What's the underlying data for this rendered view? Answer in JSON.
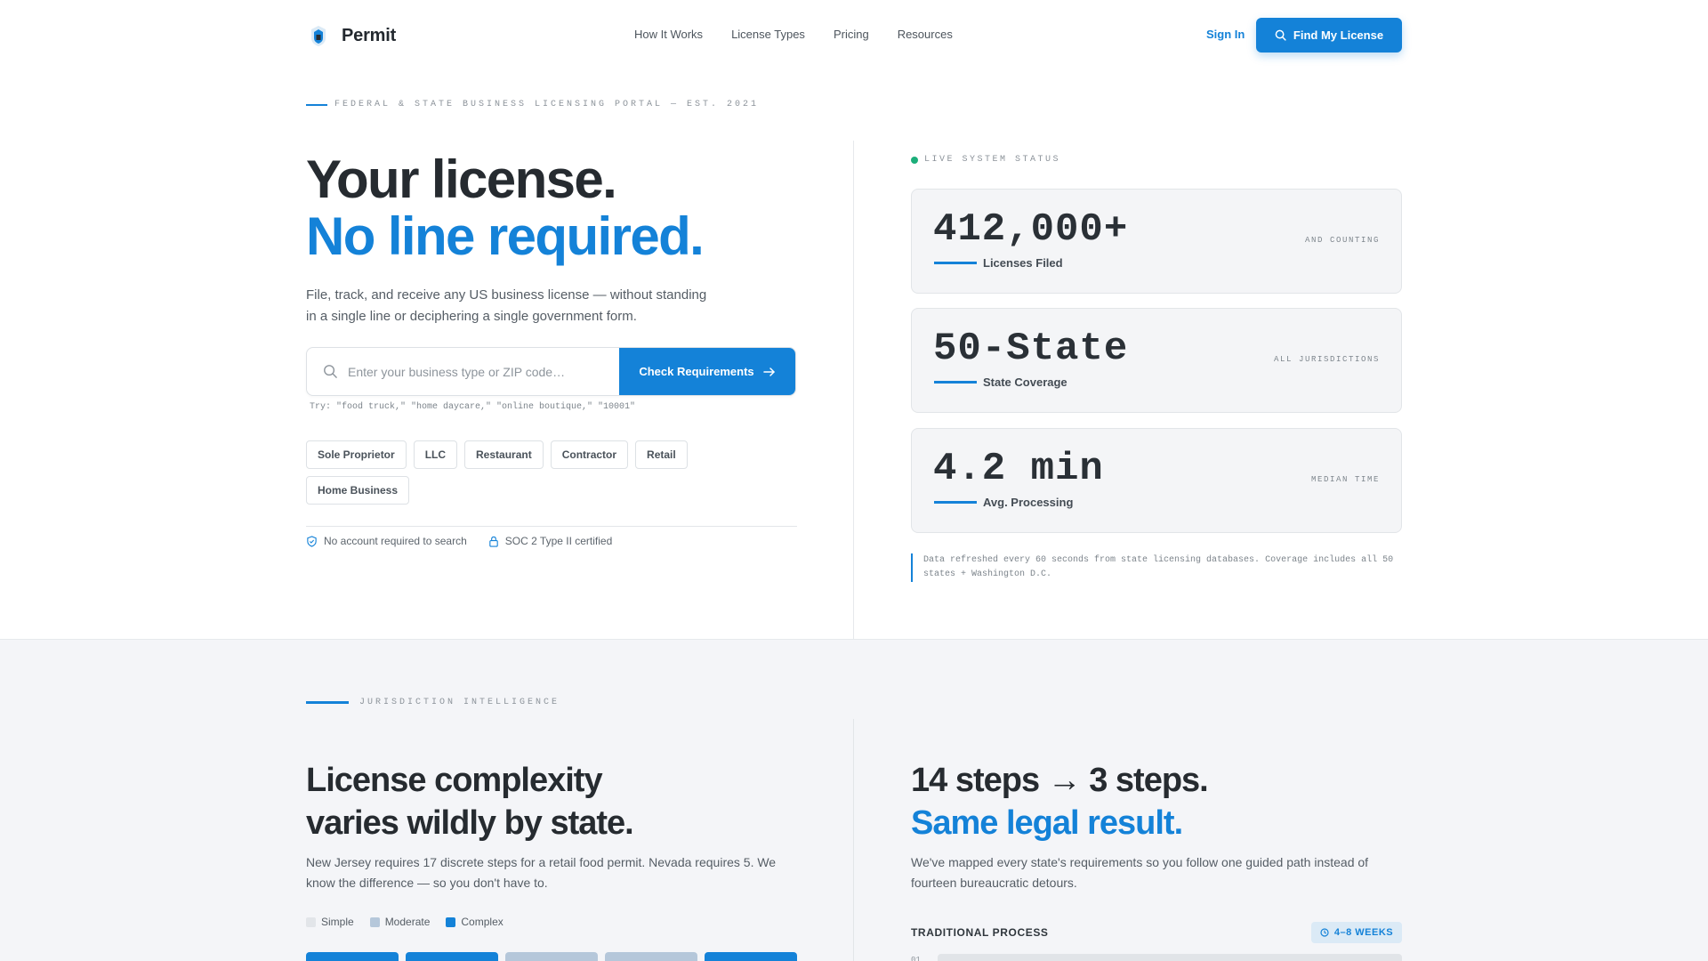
{
  "brand": {
    "name": "Permit"
  },
  "nav": {
    "items": [
      "How It Works",
      "License Types",
      "Pricing",
      "Resources"
    ]
  },
  "header": {
    "signin": "Sign In",
    "cta": "Find My License"
  },
  "hero": {
    "eyebrow": "FEDERAL & STATE BUSINESS LICENSING PORTAL — EST. 2021",
    "title_line1": "Your license.",
    "title_line2": "No line required.",
    "subtitle": "File, track, and receive any US business license — without standing in a single line or deciphering a single government form.",
    "search": {
      "placeholder": "Enter your business type or ZIP code…",
      "value": "",
      "button": "Check Requirements",
      "hint": "Try: \"food truck,\" \"home daycare,\" \"online boutique,\" \"10001\""
    },
    "chips": [
      "Sole Proprietor",
      "LLC",
      "Restaurant",
      "Contractor",
      "Retail",
      "Home Business"
    ],
    "trust": [
      "No account required to search",
      "SOC 2 Type II certified"
    ]
  },
  "status": {
    "label": "LIVE SYSTEM STATUS",
    "stats": [
      {
        "value": "412,000+",
        "label": "Licenses Filed",
        "tag": "AND COUNTING"
      },
      {
        "value": "50-State",
        "label": "State Coverage",
        "tag": "ALL JURISDICTIONS"
      },
      {
        "value": "4.2 min",
        "label": "Avg. Processing",
        "tag": "MEDIAN TIME"
      }
    ],
    "note": "Data refreshed every 60 seconds from state licensing databases. Coverage includes all 50 states + Washington D.C."
  },
  "section2": {
    "eyebrow": "JURISDICTION INTELLIGENCE",
    "left": {
      "title_line1": "License complexity",
      "title_line2": "varies wildly by state.",
      "body": "New Jersey requires 17 discrete steps for a retail food permit. Nevada requires 5. We know the difference — so you don't have to.",
      "legend": [
        "Simple",
        "Moderate",
        "Complex"
      ],
      "legend_colors": [
        "#e2e5e9",
        "#b5c7da",
        "#1482d8"
      ],
      "tiles": [
        "complex",
        "complex",
        "moderate",
        "moderate",
        "complex"
      ]
    },
    "right": {
      "title_line1": "14 steps → 3 steps.",
      "title_line2": "Same legal result.",
      "body": "We've mapped every state's requirements so you follow one guided path instead of fourteen bureaucratic detours.",
      "process_label": "TRADITIONAL PROCESS",
      "duration": "4–8 WEEKS",
      "first_step": "01"
    }
  },
  "colors": {
    "accent": "#1482d8",
    "live": "#1cae7a",
    "text": "#262b30"
  }
}
